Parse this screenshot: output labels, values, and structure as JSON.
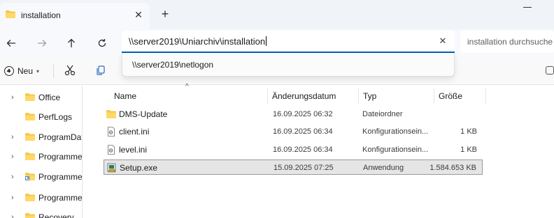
{
  "tab": {
    "title": "installation"
  },
  "address": {
    "value": "\\\\server2019\\Uniarchiv\\installation"
  },
  "search": {
    "placeholder": "installation durchsuche"
  },
  "suggestion": {
    "text": "\\\\server2019\\netlogon"
  },
  "toolbar": {
    "new_label": "Neu"
  },
  "sidebar": {
    "items": [
      {
        "label": "Office",
        "expandable": true,
        "icon": "folder-icon"
      },
      {
        "label": "PerfLogs",
        "expandable": false,
        "icon": "folder-icon"
      },
      {
        "label": "ProgramData",
        "expandable": true,
        "icon": "folder-icon"
      },
      {
        "label": "Programme",
        "expandable": true,
        "icon": "folder-icon"
      },
      {
        "label": "Programme",
        "expandable": true,
        "icon": "folder-shortcut-icon"
      },
      {
        "label": "Programme (",
        "expandable": true,
        "icon": "folder-icon"
      },
      {
        "label": "Recovery",
        "expandable": true,
        "icon": "folder-icon"
      }
    ]
  },
  "columns": {
    "name": "Name",
    "date": "Änderungsdatum",
    "type": "Typ",
    "size": "Größe"
  },
  "files": [
    {
      "name": "DMS-Update",
      "date": "16.09.2025 06:32",
      "type": "Dateiordner",
      "size": "",
      "icon": "folder-icon",
      "selected": false
    },
    {
      "name": "client.ini",
      "date": "16.09.2025 06:34",
      "type": "Konfigurationsein...",
      "size": "1 KB",
      "icon": "ini-file-icon",
      "selected": false
    },
    {
      "name": "level.ini",
      "date": "16.09.2025 06:34",
      "type": "Konfigurationsein...",
      "size": "1 KB",
      "icon": "ini-file-icon",
      "selected": false
    },
    {
      "name": "Setup.exe",
      "date": "15.09.2025 07:25",
      "type": "Anwendung",
      "size": "1.584.653 KB",
      "icon": "setup-exe-icon",
      "selected": true
    }
  ],
  "colors": {
    "accent": "#005fb8",
    "folder": "#f2c94c",
    "selection": "#e5e5e5"
  }
}
